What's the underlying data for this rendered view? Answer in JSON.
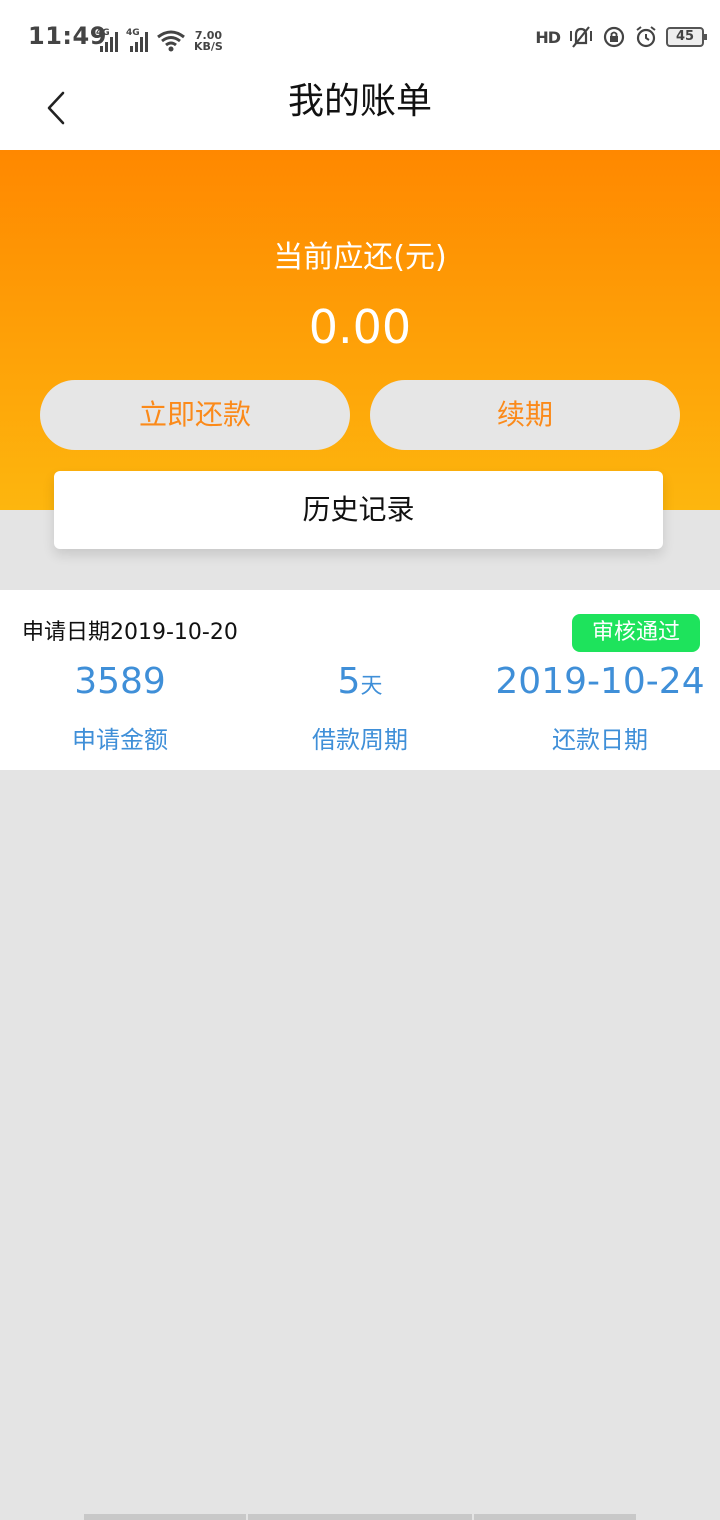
{
  "status_bar": {
    "time": "11:49",
    "signal1": "4G",
    "signal2": "4G",
    "net_speed_value": "7.00",
    "net_speed_unit": "KB/S",
    "hd_label": "HD",
    "battery": "45"
  },
  "header": {
    "title": "我的账单"
  },
  "summary": {
    "label": "当前应还(元)",
    "amount": "0.00",
    "repay_button": "立即还款",
    "renew_button": "续期",
    "history_button": "历史记录"
  },
  "bill": {
    "apply_date": "申请日期2019-10-20",
    "status": "审核通过",
    "amount_value": "3589",
    "amount_label": "申请金额",
    "period_value": "5",
    "period_unit": "天",
    "period_label": "借款周期",
    "repay_date_value": "2019-10-24",
    "repay_date_label": "还款日期"
  },
  "colors": {
    "accent_orange": "#ff8800",
    "accent_yellow": "#fdb60e",
    "button_text": "#fb8a1a",
    "stat_blue": "#3f8fd8",
    "status_green": "#1ee35c"
  }
}
